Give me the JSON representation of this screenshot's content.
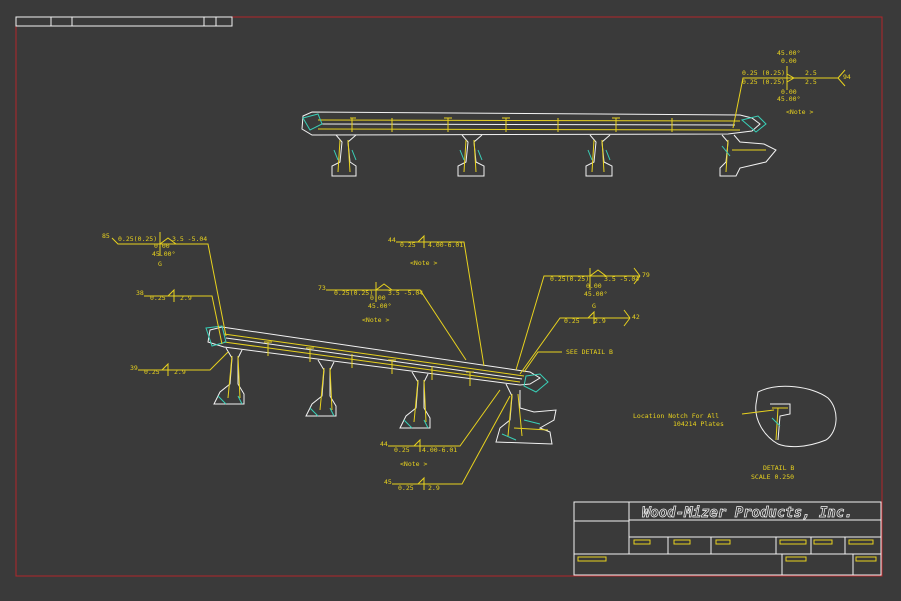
{
  "colors": {
    "background": "#3a3a3a",
    "border": "#b3262b",
    "annotation": "#e8d21e",
    "geometry": "#f2f2f2",
    "accent": "#39d0b8"
  },
  "company": "Wood-Mizer Products, Inc.",
  "top_view": {
    "weld_angle": "45.00°",
    "weld_root": "0.00",
    "weld_left_1": "0.25 (0.25)",
    "weld_left_2": "0.25 (0.25)",
    "weld_right_1": "2.5",
    "weld_right_2": "2.5",
    "weld_root_2": "0.00",
    "weld_angle_2": "45.00°",
    "balloon": "94",
    "note": "<Note >"
  },
  "callouts": {
    "c85": {
      "balloon": "85",
      "size": "0.25(0.25)",
      "length": "3.5 -5.04",
      "root": "0.00",
      "angle": "45.00°",
      "groove": "G"
    },
    "c44a": {
      "balloon": "44",
      "size": "0.25",
      "length": "4.00-6.01",
      "note": "<Note >"
    },
    "c73": {
      "balloon": "73",
      "size": "0.25(0.25)",
      "length": "3.5 -5.04",
      "root": "0.00",
      "angle": "45.00°",
      "note": "<Note >"
    },
    "c79": {
      "balloon": "79",
      "size": "0.25(0.25)",
      "length": "3.5 -5.04",
      "root": "0.00",
      "angle": "45.00°",
      "groove": "G"
    },
    "c38": {
      "balloon": "38",
      "size": "0.25",
      "length": "2.9"
    },
    "c42": {
      "balloon": "42",
      "size": "0.25",
      "length": "2.9"
    },
    "c39": {
      "balloon": "39",
      "size": "0.25",
      "length": "2.9"
    },
    "c44b": {
      "balloon": "44",
      "size": "0.25",
      "length": "4.00-6.01",
      "note": "<Note >"
    },
    "c45": {
      "balloon": "45",
      "size": "0.25",
      "length": "2.9"
    }
  },
  "see_detail": "SEE DETAIL  B",
  "detail_note_1": "Location Notch For All",
  "detail_note_2": "104214 Plates",
  "detail_title": "DETAIL  B",
  "detail_scale": "SCALE  0.250"
}
